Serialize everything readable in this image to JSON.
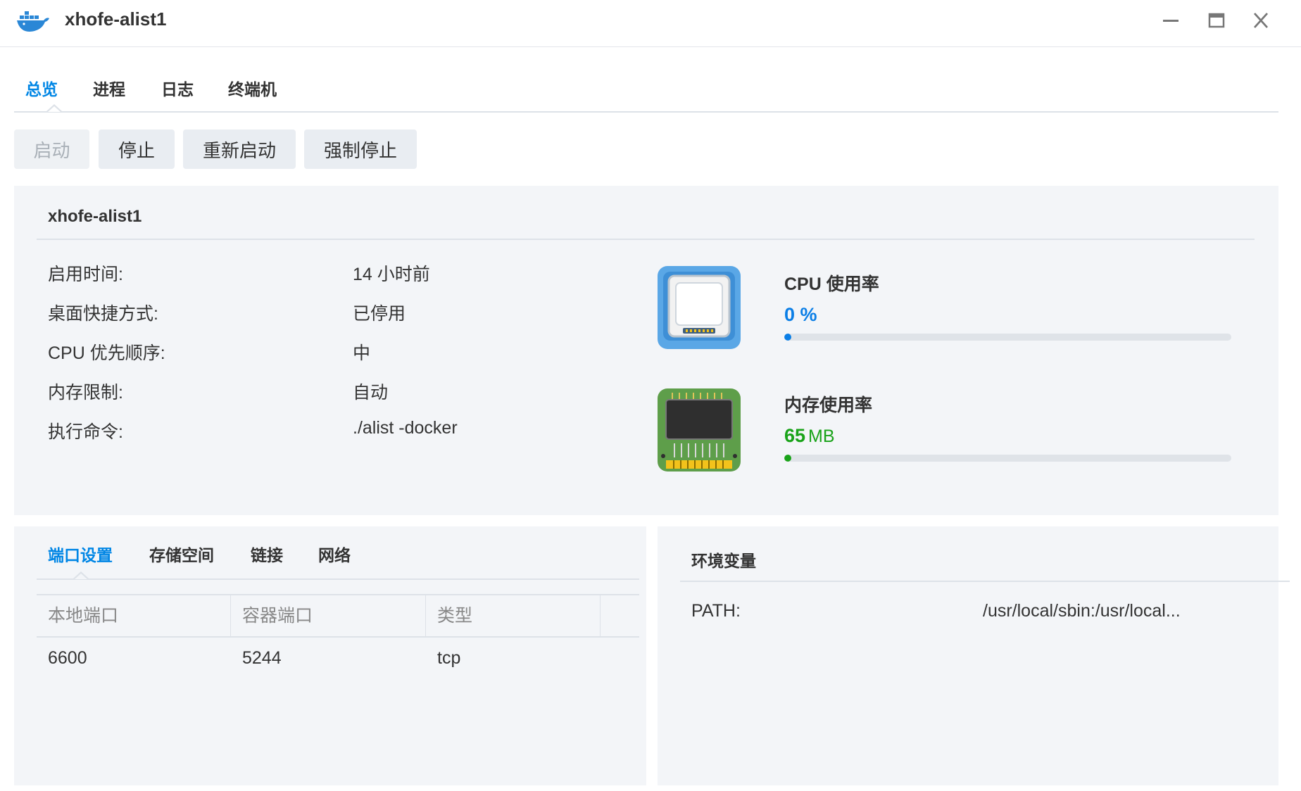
{
  "window": {
    "title": "xhofe-alist1",
    "icon": "docker-whale-icon",
    "controls": [
      "minimize-icon",
      "maximize-icon",
      "close-icon"
    ]
  },
  "tabs": [
    {
      "label": "总览",
      "active": true
    },
    {
      "label": "进程",
      "active": false
    },
    {
      "label": "日志",
      "active": false
    },
    {
      "label": "终端机",
      "active": false
    }
  ],
  "actions": {
    "start": "启动",
    "stop": "停止",
    "restart": "重新启动",
    "force_stop": "强制停止"
  },
  "info": {
    "name": "xhofe-alist1",
    "rows": [
      {
        "label": "启用时间:",
        "value": "14 小时前"
      },
      {
        "label": "桌面快捷方式:",
        "value": "已停用"
      },
      {
        "label": "CPU 优先顺序:",
        "value": "中"
      },
      {
        "label": "内存限制:",
        "value": "自动"
      },
      {
        "label": "执行命令:",
        "value": "./alist -docker"
      }
    ]
  },
  "resources": {
    "cpu": {
      "title": "CPU 使用率",
      "value": "0",
      "unit": "%",
      "fraction": 0.0,
      "color": "#0a7ee6",
      "icon": "cpu-chip-icon"
    },
    "memory": {
      "title": "内存使用率",
      "value": "65",
      "unit": "MB",
      "fraction": 0.0,
      "color": "#19a319",
      "icon": "memory-module-icon"
    }
  },
  "subtabs": [
    {
      "label": "端口设置",
      "active": true
    },
    {
      "label": "存储空间",
      "active": false
    },
    {
      "label": "链接",
      "active": false
    },
    {
      "label": "网络",
      "active": false
    }
  ],
  "ports": {
    "columns": [
      "本地端口",
      "容器端口",
      "类型"
    ],
    "rows": [
      {
        "local": "6600",
        "container": "5244",
        "type": "tcp"
      }
    ]
  },
  "env": {
    "title": "环境变量",
    "rows": [
      {
        "key": "PATH:",
        "value": "/usr/local/sbin:/usr/local..."
      }
    ]
  },
  "colors": {
    "accent": "#0086e5",
    "panel_bg": "#f3f5f8",
    "button_bg": "#e9edf2"
  }
}
